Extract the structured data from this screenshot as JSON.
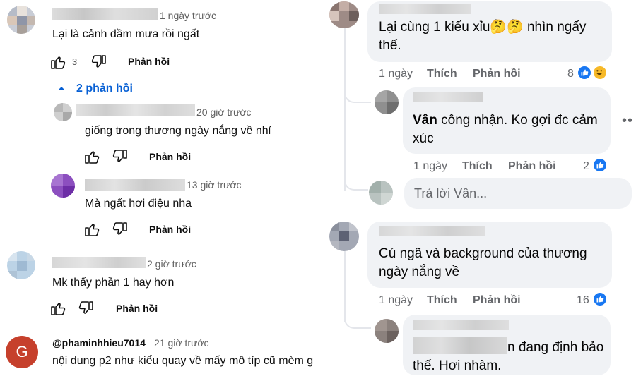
{
  "youtube": {
    "comments": [
      {
        "time": "1 ngày trước",
        "text": "Lại là cảnh dầm mưa rồi ngất",
        "likes": "3",
        "reply_label": "Phản hồi",
        "replies_toggle": "2 phản hồi",
        "replies": [
          {
            "time": "20 giờ trước",
            "text": "giống trong thương ngày nắng về nhỉ",
            "reply_label": "Phản hồi"
          },
          {
            "time": "13 giờ trước",
            "text": "Mà ngất hơi điệu nha",
            "reply_label": "Phản hồi"
          }
        ]
      },
      {
        "time": "2 giờ trước",
        "text": "Mk thấy phần 1 hay hơn",
        "reply_label": "Phản hồi"
      },
      {
        "avatar_letter": "G",
        "handle": "@phaminhhieu7014",
        "time": "21 giờ trước",
        "text": "nội dung p2 như kiểu quay về mấy mô típ cũ mèm g"
      }
    ],
    "colors": {
      "avatar_g": "#c6402c",
      "link": "#065fd4"
    }
  },
  "facebook": {
    "comments": [
      {
        "text": "Lại cùng 1 kiểu xỉu🤔🤔 nhìn ngấy thế.",
        "age": "1 ngày",
        "like_label": "Thích",
        "reply_label": "Phản hồi",
        "reaction_count": "8",
        "reactions": [
          "like-icon",
          "haha-icon"
        ],
        "replies": [
          {
            "author": "Vân",
            "text": " công nhận. Ko gợi đc cảm xúc",
            "age": "1 ngày",
            "like_label": "Thích",
            "reply_label": "Phản hồi",
            "reaction_count": "2",
            "reactions": [
              "like-icon"
            ]
          }
        ],
        "reply_placeholder": "Trả lời Vân..."
      },
      {
        "text": "Cú ngã và background của thương ngày nắng về",
        "age": "1 ngày",
        "like_label": "Thích",
        "reply_label": "Phản hồi",
        "reaction_count": "16",
        "reactions": [
          "like-icon"
        ],
        "replies": [
          {
            "text_visible": "n đang định bảo thế. Hơi nhàm."
          }
        ]
      }
    ],
    "colors": {
      "like_blue": "#1877f2",
      "haha_yellow": "#f7b928",
      "bubble": "#f0f2f5"
    },
    "more_icon": "ellipsis-icon"
  }
}
